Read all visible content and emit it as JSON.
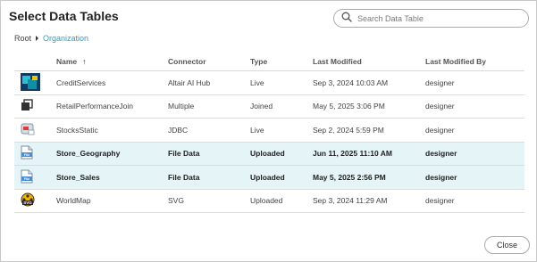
{
  "dialog": {
    "title": "Select Data Tables",
    "search": {
      "placeholder": "Search Data Table",
      "value": ""
    },
    "breadcrumb": {
      "root": "Root",
      "current": "Organization"
    },
    "columns": {
      "name": "Name",
      "connector": "Connector",
      "type": "Type",
      "last_modified": "Last Modified",
      "last_modified_by": "Last Modified By"
    },
    "sort_arrow": "↑",
    "rows": [
      {
        "icon": "altair-data-icon",
        "name": "CreditServices",
        "connector": "Altair AI Hub",
        "type": "Live",
        "last_modified": "Sep 3, 2024 10:03 AM",
        "last_modified_by": "designer",
        "selected": false
      },
      {
        "icon": "join-icon",
        "name": "RetailPerformanceJoin",
        "connector": "Multiple",
        "type": "Joined",
        "last_modified": "May 5, 2025 3:06 PM",
        "last_modified_by": "designer",
        "selected": false
      },
      {
        "icon": "jdbc-icon",
        "name": "StocksStatic",
        "connector": "JDBC",
        "type": "Live",
        "last_modified": "Sep 2, 2024 5:59 PM",
        "last_modified_by": "designer",
        "selected": false
      },
      {
        "icon": "file-icon",
        "name": "Store_Geography",
        "connector": "File Data",
        "type": "Uploaded",
        "last_modified": "Jun 11, 2025 11:10 AM",
        "last_modified_by": "designer",
        "selected": true
      },
      {
        "icon": "file-icon",
        "name": "Store_Sales",
        "connector": "File Data",
        "type": "Uploaded",
        "last_modified": "May 5, 2025 2:56 PM",
        "last_modified_by": "designer",
        "selected": true
      },
      {
        "icon": "svg-file-icon",
        "name": "WorldMap",
        "connector": "SVG",
        "type": "Uploaded",
        "last_modified": "Sep 3, 2024 11:29 AM",
        "last_modified_by": "designer",
        "selected": false
      }
    ],
    "file_icon_label": "File",
    "svg_icon_label": "SVG",
    "close_label": "Close",
    "colors": {
      "accent": "#2aa0c0",
      "selected_row": "#e4f4f7"
    }
  }
}
